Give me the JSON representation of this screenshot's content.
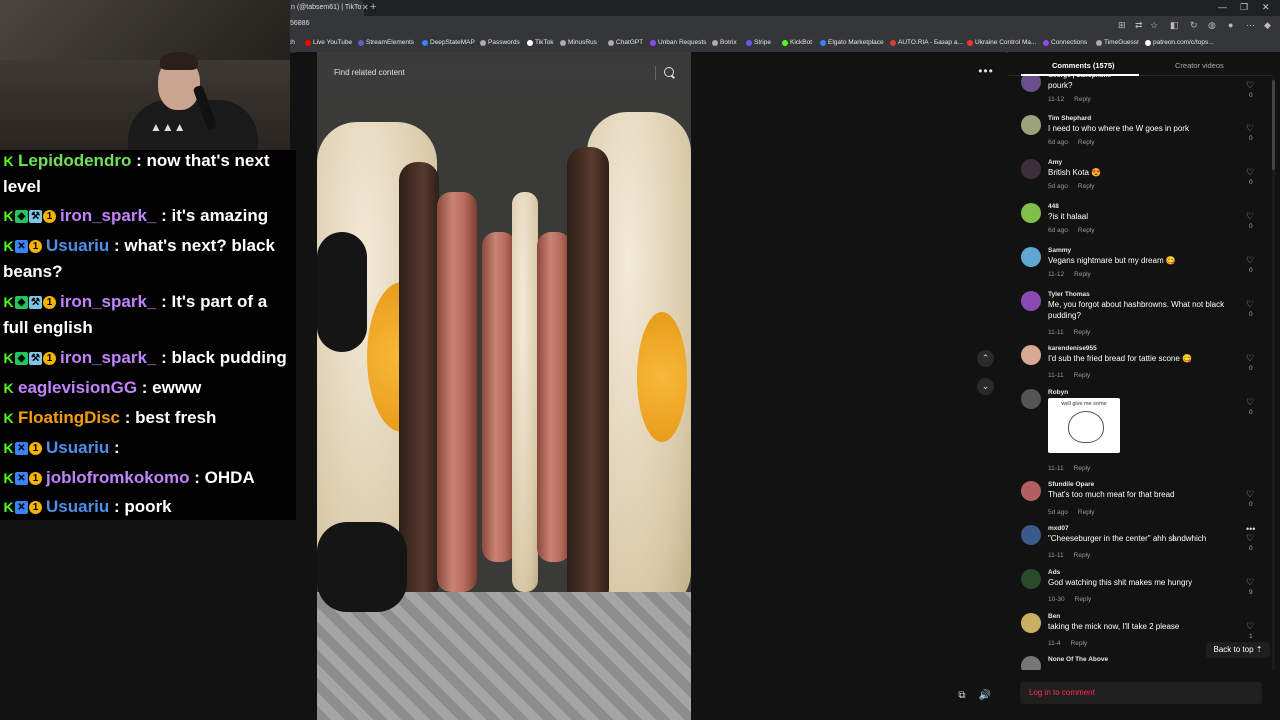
{
  "browser": {
    "tab_title": "n (@tabsem61) | TikTo",
    "url": "56886",
    "bookmarks": [
      {
        "label": "ch",
        "color": "#888"
      },
      {
        "label": "Live YouTube",
        "color": "#ff0000"
      },
      {
        "label": "StreamElements",
        "color": "#6a5acd"
      },
      {
        "label": "DeepStateMAP",
        "color": "#3b82f6"
      },
      {
        "label": "Passwords",
        "color": "#aaaaaa"
      },
      {
        "label": "TikTok",
        "color": "#ffffff"
      },
      {
        "label": "MinusRus",
        "color": "#aaaaaa"
      },
      {
        "label": "ChatGPT",
        "color": "#aaaaaa"
      },
      {
        "label": "Unban Requests",
        "color": "#9146ff"
      },
      {
        "label": "Botrix",
        "color": "#aaaaaa"
      },
      {
        "label": "Stripe",
        "color": "#635bff"
      },
      {
        "label": "KickBot",
        "color": "#53fc18"
      },
      {
        "label": "Elgato Marketplace",
        "color": "#3b82f6"
      },
      {
        "label": "AUTO.RIA - Базар а...",
        "color": "#e53935"
      },
      {
        "label": "Ukraine Control Ma...",
        "color": "#e53935"
      },
      {
        "label": "Connections",
        "color": "#9146ff"
      },
      {
        "label": "TimeGuessr",
        "color": "#aaaaaa"
      },
      {
        "label": "patreon.com/c/tops...",
        "color": "#ffffff"
      }
    ]
  },
  "chat": {
    "messages": [
      {
        "badges": [
          "k"
        ],
        "user": "Lepidodendro",
        "user_color": "#6ee05a",
        "text": ": now that's next level"
      },
      {
        "badges": [
          "k",
          "g",
          "t",
          "1"
        ],
        "user": "iron_spark_",
        "user_color": "#c084fc",
        "text": ": it's amazing"
      },
      {
        "badges": [
          "k",
          "s",
          "1"
        ],
        "user": "Usuariu",
        "user_color": "#4f8fe8",
        "text": ": what's next? black beans?"
      },
      {
        "badges": [
          "k",
          "g",
          "t",
          "1"
        ],
        "user": "iron_spark_",
        "user_color": "#c084fc",
        "text": ": It's part of a full english"
      },
      {
        "badges": [
          "k",
          "g",
          "t",
          "1"
        ],
        "user": "iron_spark_",
        "user_color": "#c084fc",
        "text": ": black pudding"
      },
      {
        "badges": [
          "k"
        ],
        "user": "eaglevisionGG",
        "user_color": "#c084fc",
        "text": ": ewww"
      },
      {
        "badges": [
          "k"
        ],
        "user": "FloatingDisc",
        "user_color": "#f59e0b",
        "text": ": best fresh"
      },
      {
        "badges": [
          "k",
          "s",
          "1"
        ],
        "user": "Usuariu",
        "user_color": "#4f8fe8",
        "text": ":"
      },
      {
        "badges": [
          "k",
          "s",
          "1"
        ],
        "user": "joblofromkokomo",
        "user_color": "#c084fc",
        "text": ": OHDA"
      },
      {
        "badges": [
          "k",
          "s",
          "1"
        ],
        "user": "Usuariu",
        "user_color": "#4f8fe8",
        "text": ": poork"
      }
    ]
  },
  "video": {
    "search_placeholder": "Find related content"
  },
  "panel": {
    "tab_comments": "Comments (1575)",
    "tab_creator": "Creator videos",
    "back_to_top": "Back to top",
    "login": "Log in to comment",
    "comments": [
      {
        "name": "George | Saxophone",
        "text": "pourk?",
        "date": "11-12",
        "reply": "Reply",
        "likes": "0",
        "avatar": "#6b4f8a"
      },
      {
        "name": "Tim Shephard",
        "text": "I need to who where the W goes in pork",
        "date": "6d ago",
        "reply": "Reply",
        "likes": "0",
        "avatar": "#9aa37a"
      },
      {
        "name": "Amy",
        "text": "British Kota 😍",
        "date": "5d ago",
        "reply": "Reply",
        "likes": "0",
        "avatar": "#3a2f3a"
      },
      {
        "name": "448",
        "text": "?is it halaal",
        "date": "6d ago",
        "reply": "Reply",
        "likes": "0",
        "avatar": "#7fbf4a"
      },
      {
        "name": "Sammy",
        "text": "Vegans nightmare but my dream 😋",
        "date": "11-12",
        "reply": "Reply",
        "likes": "0",
        "avatar": "#5fa8d3"
      },
      {
        "name": "Tyler Thomas",
        "text": "Me, you forgot about hashbrowns. What not black pudding?",
        "date": "11-11",
        "reply": "Reply",
        "likes": "0",
        "avatar": "#8a4ab0"
      },
      {
        "name": "karendenise955",
        "text": "I'd sub the fried bread for tattie scone 😋",
        "date": "11-11",
        "reply": "Reply",
        "likes": "0",
        "avatar": "#d8a890"
      },
      {
        "name": "Robyn",
        "text": "",
        "date": "11-11",
        "reply": "Reply",
        "likes": "0",
        "avatar": "#555555",
        "sticker": "well give me some"
      },
      {
        "name": "Sfundile Opare",
        "text": "That's too much meat for that bread",
        "date": "5d ago",
        "reply": "Reply",
        "likes": "0",
        "avatar": "#b06060"
      },
      {
        "name": "mxd07",
        "text": "\"Cheeseburger in the center\" ahh sandwhich",
        "date": "11-11",
        "reply": "Reply",
        "likes": "0",
        "avatar": "#3a5a8a"
      },
      {
        "name": "Ads",
        "text": "God watching this shit makes me hungry",
        "date": "10-30",
        "reply": "Reply",
        "likes": "9",
        "avatar": "#2a4a2a"
      },
      {
        "name": "Ben",
        "text": "taking the mick now, I'll take 2 please",
        "date": "11-4",
        "reply": "Reply",
        "likes": "1",
        "avatar": "#c8b060"
      },
      {
        "name": "None Of The Above",
        "text": "",
        "date": "",
        "reply": "",
        "likes": "",
        "avatar": "#777777"
      }
    ]
  }
}
